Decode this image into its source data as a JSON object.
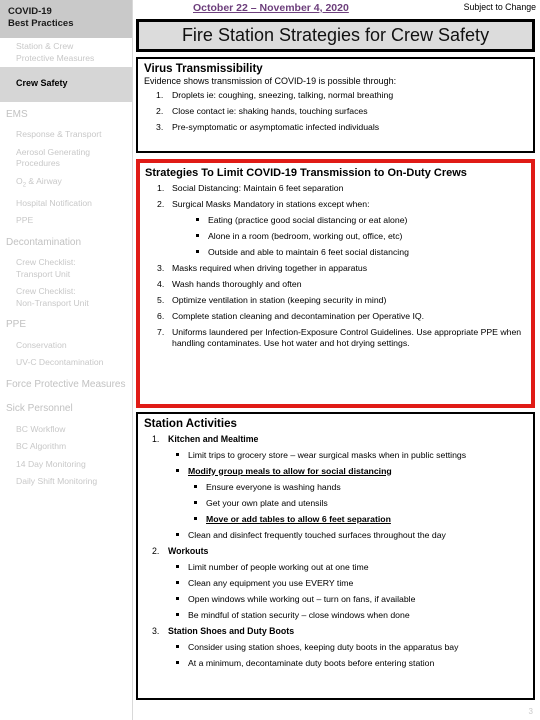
{
  "sidebar": {
    "header": {
      "line1": "COVID-19",
      "line2": "Best Practices"
    },
    "section1": {
      "item1": "Station & Crew",
      "item1b": "Protective Measures",
      "item2": "Crew Safety"
    },
    "groups": [
      {
        "label": "EMS",
        "items": [
          "Response & Transport",
          "Aerosol Generating",
          "Procedures",
          "Hospital Notification",
          "PPE"
        ],
        "o2_prefix": "O",
        "o2_sub": "2",
        "o2_suffix": " & Airway"
      },
      {
        "label": "Decontamination",
        "items": [
          "Crew Checklist:",
          "Transport Unit",
          "Crew Checklist:",
          "Non-Transport Unit"
        ]
      },
      {
        "label": "PPE",
        "items": [
          "Conservation",
          "UV-C Decontamination"
        ]
      },
      {
        "label": "Force Protective Measures",
        "items": []
      },
      {
        "label": "Sick Personnel",
        "items": [
          "BC Workflow",
          "BC Algorithm",
          "14 Day Monitoring",
          "Daily Shift Monitoring"
        ]
      }
    ]
  },
  "header": {
    "date_range": "October 22 – November 4, 2020",
    "subject_to_change": "Subject to Change",
    "title": "Fire Station Strategies for Crew Safety",
    "date_color": "#6d3f7c"
  },
  "virus_panel": {
    "title": "Virus Transmissibility",
    "lead": "Evidence shows transmission of COVID-19 is possible through:",
    "items": [
      {
        "n": "1.",
        "text": "Droplets  ie: coughing, sneezing, talking, normal breathing"
      },
      {
        "n": "2.",
        "text": "Close contact  ie: shaking hands, touching surfaces"
      },
      {
        "n": "3.",
        "text": "Pre-symptomatic or asymptomatic infected individuals"
      }
    ]
  },
  "strategies_panel": {
    "title": "Strategies To Limit COVID-19 Transmission to On-Duty Crews",
    "border_color": "#e01b16",
    "items": [
      {
        "n": "1.",
        "text": "Social Distancing: Maintain 6 feet separation"
      },
      {
        "n": "2.",
        "text": "Surgical Masks Mandatory in stations except when:"
      }
    ],
    "exceptions": [
      "Eating (practice good social distancing or eat alone)",
      "Alone in a room (bedroom, working out, office, etc)",
      "Outside and able to maintain 6 feet social distancing"
    ],
    "items_cont": [
      {
        "n": "3.",
        "text": "Masks required when driving together in apparatus"
      },
      {
        "n": "4.",
        "text": "Wash hands thoroughly and often"
      },
      {
        "n": "5.",
        "text": "Optimize ventilation in station (keeping security in mind)"
      },
      {
        "n": "6.",
        "text": "Complete station cleaning and decontamination per Operative IQ."
      },
      {
        "n": "7.",
        "text": "Uniforms laundered per Infection-Exposure Control Guidelines.  Use appropriate PPE when handling contaminates.  Use hot water and hot drying settings."
      }
    ]
  },
  "activities_panel": {
    "title": "Station Activities",
    "sections": [
      {
        "n": "1.",
        "heading": "Kitchen and Mealtime",
        "bullets": [
          "Limit trips to grocery store – wear surgical masks when in public settings"
        ],
        "emph_bullet": "Modify group meals to allow for social distancing",
        "sub_bullets": [
          {
            "text": "Ensure everyone is washing hands",
            "emph": false
          },
          {
            "text": "Get your own plate and utensils",
            "emph": false
          },
          {
            "text": "Move or add tables to allow 6 feet separation",
            "emph": true
          }
        ],
        "tail_bullets": [
          "Clean and disinfect frequently touched surfaces throughout the day"
        ]
      },
      {
        "n": "2.",
        "heading": "Workouts",
        "bullets": [
          "Limit number of people working out at one time",
          "Clean any equipment you use EVERY time",
          "Open windows while working out – turn on fans, if available",
          "Be mindful of station security – close windows when done"
        ]
      },
      {
        "n": "3.",
        "heading": "Station Shoes and Duty Boots",
        "bullets": [
          "Consider using station shoes, keeping duty boots in the apparatus bay",
          "At a minimum, decontaminate duty boots before entering station"
        ]
      }
    ]
  },
  "page_number": "3"
}
